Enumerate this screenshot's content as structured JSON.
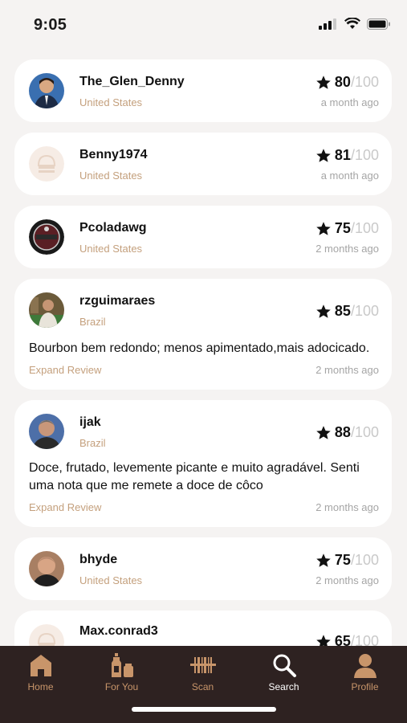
{
  "status": {
    "time": "9:05"
  },
  "reviews": [
    {
      "username": "The_Glen_Denny",
      "country": "United States",
      "score": "80",
      "max": "/100",
      "ago": "a month ago"
    },
    {
      "username": "Benny1974",
      "country": "United States",
      "score": "81",
      "max": "/100",
      "ago": "a month ago"
    },
    {
      "username": "Pcoladawg",
      "country": "United States",
      "score": "75",
      "max": "/100",
      "ago": "2 months ago"
    },
    {
      "username": "rzguimaraes",
      "country": "Brazil",
      "score": "85",
      "max": "/100",
      "ago": "2 months ago",
      "text": "Bourbon bem redondo; menos apimentado,mais adocicado.",
      "expand": "Expand Review"
    },
    {
      "username": "ijak",
      "country": "Brazil",
      "score": "88",
      "max": "/100",
      "ago": "2 months ago",
      "text": "Doce, frutado, levemente picante e muito agradável. Senti uma nota que me remete a doce de côco",
      "expand": "Expand Review"
    },
    {
      "username": "bhyde",
      "country": "United States",
      "score": "75",
      "max": "/100",
      "ago": "2 months ago"
    },
    {
      "username": "Max.conrad3",
      "score": "65",
      "max": "/100"
    }
  ],
  "tabs": [
    {
      "label": "Home",
      "icon": "home-icon"
    },
    {
      "label": "For You",
      "icon": "for-you-icon"
    },
    {
      "label": "Scan",
      "icon": "barcode-scan-icon"
    },
    {
      "label": "Search",
      "icon": "search-icon",
      "active": true
    },
    {
      "label": "Profile",
      "icon": "profile-icon"
    }
  ],
  "colors": {
    "accent": "#c4a07d",
    "tab_bar": "#2e2221",
    "background": "#f5f3f2"
  }
}
